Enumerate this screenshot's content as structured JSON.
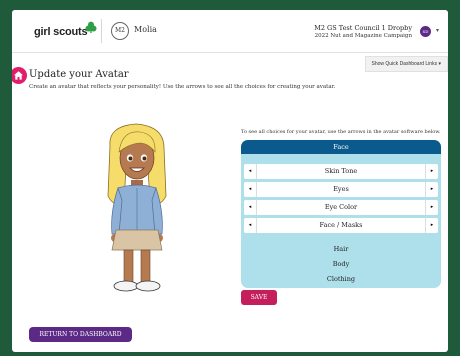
{
  "header": {
    "logo_text": "girl scouts",
    "logo_icon": "trefoil-icon",
    "app_badge": "M2",
    "app_name": "Molia",
    "council_line1": "M2 GS Test Council 1 Dropby",
    "council_line2": "2022 Nut and Magazine Campaign",
    "user_initials": "SD",
    "user_menu_icon": "caret-down-icon"
  },
  "quick_links_label": "Show Quick Dashboard Links ▾",
  "page": {
    "icon": "home-icon",
    "title": "Update your Avatar",
    "subtitle": "Create an avatar that reflects your personality! Use the arrows to see all the choices for creating your avatar."
  },
  "editor": {
    "instruction": "To see all choices for your avatar, use the arrows in the avatar software below.",
    "section": "Face",
    "options": [
      {
        "label": "Skin Tone"
      },
      {
        "label": "Eyes"
      },
      {
        "label": "Eye Color"
      },
      {
        "label": "Face / Masks"
      }
    ],
    "arrow_left": "◂",
    "arrow_right": "▸",
    "categories": [
      "Hair",
      "Body",
      "Clothing"
    ]
  },
  "buttons": {
    "save": "SAVE",
    "return": "RETURN TO DASHBOARD"
  },
  "colors": {
    "page_background": "#1f5a3a",
    "editor_header": "#0b5a8e",
    "editor_body": "#aee0ec",
    "save_button": "#c41e5c",
    "return_button": "#5c2a86",
    "home_icon": "#e01e6b",
    "brand_green": "#2f9e44"
  }
}
